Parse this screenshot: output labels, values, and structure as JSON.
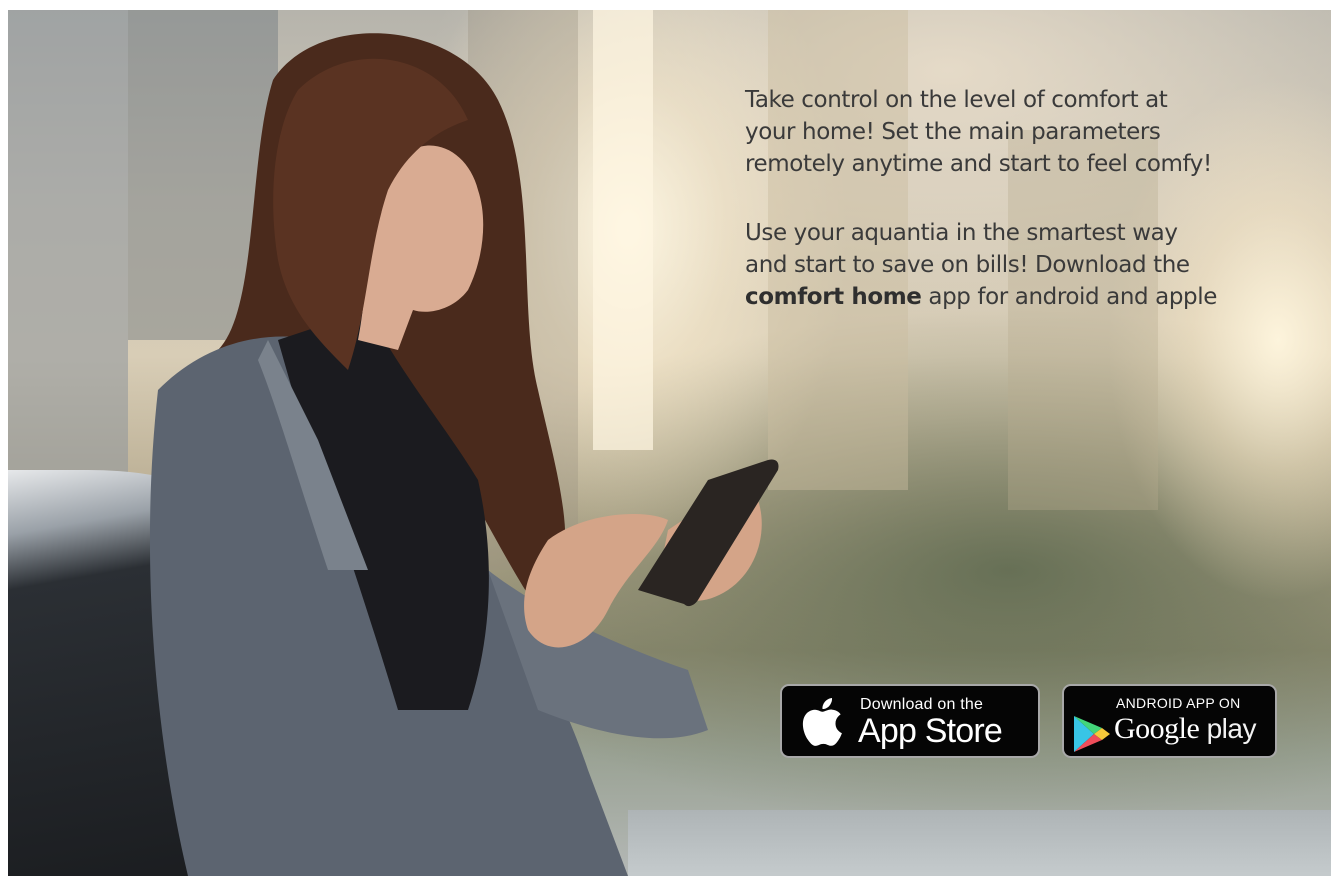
{
  "copy": {
    "paragraph1": {
      "line1": "Take control on the level of comfort at",
      "line2": "your home! Set the main parameters",
      "line3": "remotely  anytime and start to feel comfy!"
    },
    "paragraph2": {
      "line1": "Use your aquantia in the smartest way",
      "line2": "and  start to save on bills! Download the",
      "line3_bold": "comfort home",
      "line3_rest": " app for android and apple"
    }
  },
  "badges": {
    "app_store": {
      "small": "Download on the",
      "big": "App Store",
      "icon": "apple-icon"
    },
    "google_play": {
      "small": "ANDROID APP ON",
      "big_main": "Google",
      "big_suffix": " play",
      "icon": "google-play-icon"
    }
  }
}
